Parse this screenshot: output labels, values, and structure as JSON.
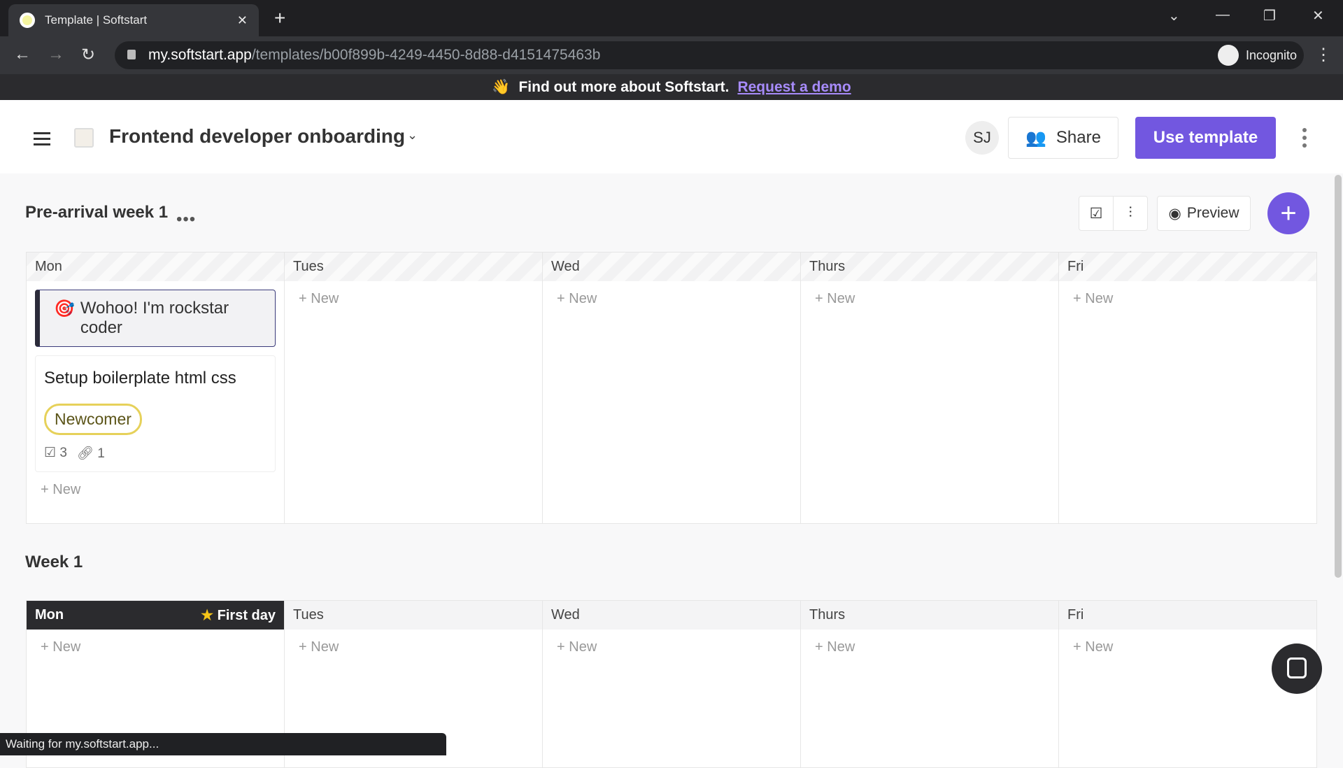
{
  "browser": {
    "tab_title": "Template | Softstart",
    "url_host": "my.softstart.app",
    "url_path": "/templates/b00f899b-4249-4450-8d88-d4151475463b",
    "profile": "Incognito",
    "status": "Waiting for my.softstart.app..."
  },
  "banner": {
    "emoji": "👋",
    "text": "Find out more about Softstart.",
    "link": "Request a demo"
  },
  "header": {
    "title": "Frontend developer onboarding",
    "avatar": "SJ",
    "share": "Share",
    "use_template": "Use template"
  },
  "toolbar": {
    "preview": "Preview"
  },
  "sections": [
    {
      "title": "Pre-arrival week 1",
      "columns": [
        "Mon",
        "Tues",
        "Wed",
        "Thurs",
        "Fri"
      ],
      "cards": [
        {
          "type": "milestone",
          "emoji": "🎯",
          "title": "Wohoo! I'm rockstar coder"
        },
        {
          "type": "task",
          "title": "Setup boilerplate html css",
          "tag": "Newcomer",
          "checklist": "3",
          "links": "1"
        }
      ]
    },
    {
      "title": "Week 1",
      "columns": [
        "Mon",
        "Tues",
        "Wed",
        "Thurs",
        "Fri"
      ],
      "first_day": "First day"
    }
  ],
  "new_label": "New",
  "colors": {
    "accent": "#7257e0",
    "tag_border": "#e6d15a"
  }
}
